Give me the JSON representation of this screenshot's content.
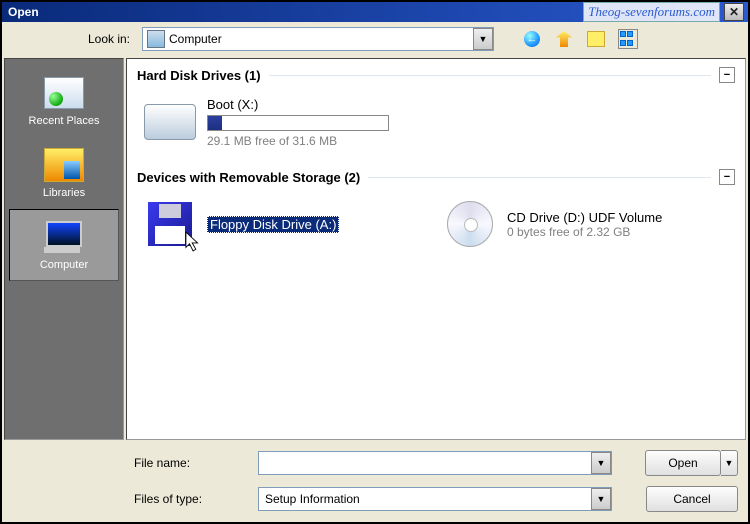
{
  "title": "Open",
  "watermark": "Theog-sevenforums.com",
  "lookin": {
    "label": "Look in:",
    "value": "Computer"
  },
  "places": [
    {
      "id": "recent",
      "label": "Recent Places"
    },
    {
      "id": "libraries",
      "label": "Libraries"
    },
    {
      "id": "computer",
      "label": "Computer"
    }
  ],
  "groups": {
    "hdd": {
      "header": "Hard Disk Drives (1)",
      "items": [
        {
          "name": "Boot (X:)",
          "sub": "29.1 MB free of 31.6 MB",
          "used_ratio": 0.08
        }
      ]
    },
    "removable": {
      "header": "Devices with Removable Storage (2)",
      "items": [
        {
          "name": "Floppy Disk Drive (A:)",
          "sub": ""
        },
        {
          "name": "CD Drive (D:) UDF Volume",
          "sub": "0 bytes free of 2.32 GB"
        }
      ]
    }
  },
  "bottom": {
    "filename_label": "File name:",
    "filename_value": "",
    "filetype_label": "Files of type:",
    "filetype_value": "Setup Information",
    "open_label": "Open",
    "cancel_label": "Cancel"
  },
  "collapse_glyph": "−"
}
